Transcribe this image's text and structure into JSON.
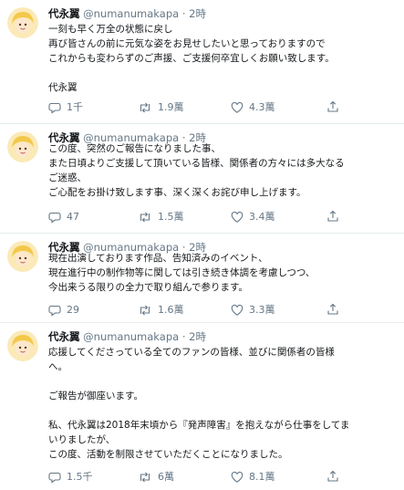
{
  "tweets": [
    {
      "name": "代永翼",
      "handle": "@numanumakapa",
      "dot": "·",
      "time": "2時",
      "lines": [
        "一刻も早く万全の状態に戻し",
        "再び皆さんの前に元気な姿をお見せしたいと思っておりますので",
        "これからも変わらずのご声援、ご支援何卒宜しくお願い致します。",
        "",
        "代永翼"
      ],
      "replies": "1千",
      "retweets": "1.9萬",
      "likes": "4.3萬"
    },
    {
      "name": "代永翼",
      "handle": "@numanumakapa",
      "dot": "·",
      "time": "2時",
      "lines": [
        "この度、突然のご報告になりました事、",
        "また日頃よりご支援して頂いている皆様、関係者の方々には多大なる",
        "ご迷惑、",
        "ご心配をお掛け致します事、深く深くお詫び申し上げます。"
      ],
      "replies": "47",
      "retweets": "1.5萬",
      "likes": "3.4萬"
    },
    {
      "name": "代永翼",
      "handle": "@numanumakapa",
      "dot": "·",
      "time": "2時",
      "lines": [
        "現在出演しております作品、告知済みのイベント、",
        "現在進行中の制作物等に関しては引き続き体調を考慮しつつ、",
        "今出来うる限りの全力で取り組んで参ります。"
      ],
      "replies": "29",
      "retweets": "1.6萬",
      "likes": "3.3萬"
    },
    {
      "name": "代永翼",
      "handle": "@numanumakapa",
      "dot": "·",
      "time": "2時",
      "lines": [
        "応援してくださっている全てのファンの皆様、並びに関係者の皆様",
        "へ。",
        "",
        "ご報告が御座います。",
        "",
        "私、代永翼は2018年末頃から『発声障害』を抱えながら仕事をしてま",
        "いりましたが、",
        "この度、活動を制限させていただくことになりました。"
      ],
      "replies": "1.5千",
      "retweets": "6萬",
      "likes": "8.1萬"
    }
  ],
  "icons": {
    "reply": "reply-icon",
    "retweet": "retweet-icon",
    "like": "heart-icon",
    "share": "share-icon",
    "avatar": "avatar-cartoon"
  },
  "colors": {
    "text": "#14171a",
    "muted": "#657786",
    "divider": "#e6ecf0"
  }
}
